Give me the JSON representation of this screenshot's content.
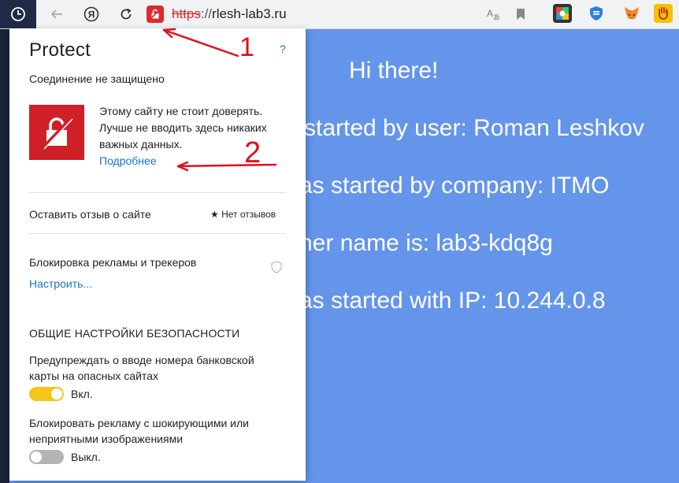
{
  "colors": {
    "accent": "#e0282f",
    "link": "#1a73c8",
    "page_bg": "#6495ea",
    "toggle_on": "#f5c518",
    "toggle_off": "#b4b4b4",
    "annotation": "#e0101a"
  },
  "browser": {
    "url_scheme": "https",
    "url_sep": "://",
    "url_host": "rlesh-lab3.ru",
    "icons": [
      "clock-icon",
      "back-arrow-icon",
      "yandex-icon",
      "reload-icon",
      "translate-icon",
      "bookmark-icon"
    ],
    "extensions": [
      "colorful-extension-icon",
      "blue-shield-extension-icon",
      "metamask-fox-icon",
      "hand-extension-icon"
    ]
  },
  "page": {
    "lines": [
      "Hi there!",
      "started by user: Roman Leshkov",
      "as started by company: ITMO",
      "ner name is: lab3-kdq8g",
      "as started with IP: 10.244.0.8"
    ]
  },
  "popup": {
    "title": "Protect",
    "help": "?",
    "connection_status": "Соединение не защищено",
    "warning_text": "Этому сайту не стоит доверять. Лучше не вводить здесь никаких важных данных.",
    "more_link": "Подробнее",
    "feedback_label": "Оставить отзыв о сайте",
    "feedback_count": "★ Нет отзывов",
    "adblock_label": "Блокировка рекламы и трекеров",
    "adblock_config": "Настроить...",
    "section_heading": "ОБЩИЕ НАСТРОЙКИ БЕЗОПАСНОСТИ",
    "options": [
      {
        "label": "Предупреждать о вводе номера банковской карты на опасных сайтах",
        "state": "Вкл.",
        "on": true
      },
      {
        "label": "Блокировать рекламу с шокирующими или неприятными изображениями",
        "state": "Выкл.",
        "on": false
      }
    ]
  },
  "annotations": {
    "arrow1_label": "1",
    "arrow2_label": "2"
  }
}
